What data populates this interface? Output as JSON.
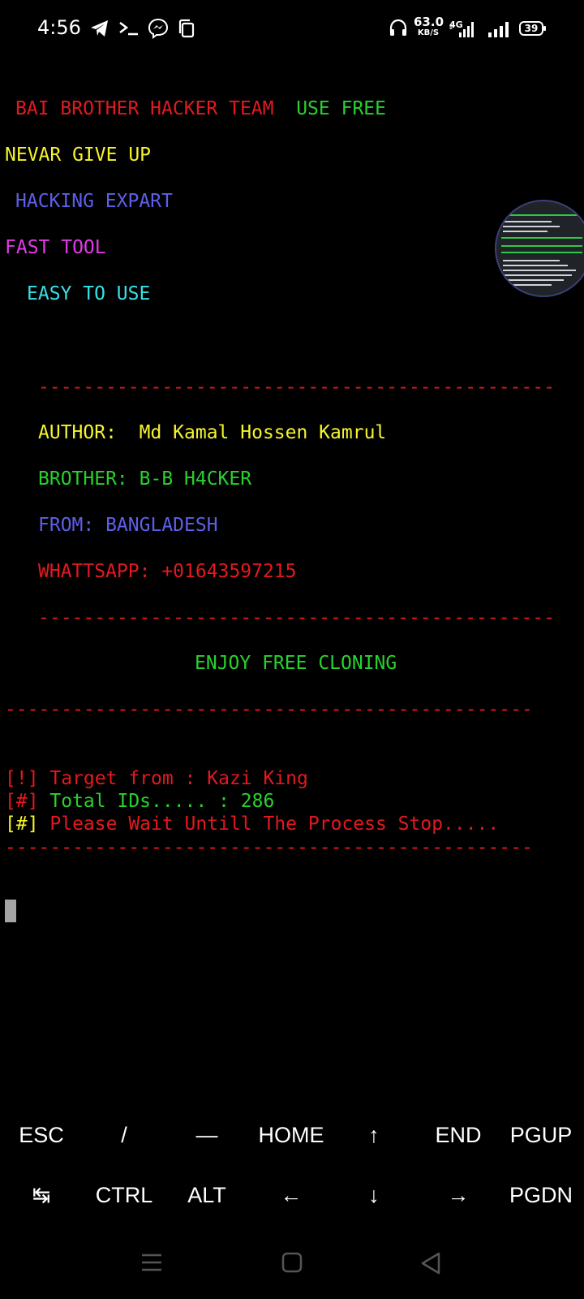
{
  "status_bar": {
    "time": "4:56",
    "net_speed_value": "63.0",
    "net_speed_unit": "KB/S",
    "network_type": "4G",
    "battery_level": "39",
    "icons": [
      "telegram-icon",
      "terminal-icon",
      "messenger-icon",
      "copy-icon",
      "headset-icon",
      "signal-4g-icon",
      "signal-icon",
      "battery-icon"
    ]
  },
  "banner": {
    "team": "BAI BROTHER HACKER TEAM",
    "use_free": "USE FREE",
    "never_give_up": "NEVAR GIVE UP",
    "hacking_expert": "HACKING EXPART",
    "fast_tool": "FAST TOOL",
    "easy_to_use": "EASY TO USE",
    "divider": "----------------------------------------------"
  },
  "info": {
    "author": "AUTHOR:  Md Kamal Hossen Kamrul",
    "brother": "BROTHER: B-B H4CKER",
    "from": "FROM: BANGLADESH",
    "whatsapp": "WHATTSAPP: +01643597215",
    "enjoy": "ENJOY FREE CLONING"
  },
  "output": {
    "target_prefix": "[!]",
    "target_text": " Target from : Kazi King",
    "total_prefix": "[#]",
    "total_text": " Total IDs..... : 286",
    "wait_prefix": "[#]",
    "wait_text": " Please Wait Untill The Process Stop.....",
    "divider_long": "-----------------------------------------------"
  },
  "extra_keys": {
    "row1": [
      "ESC",
      "/",
      "—",
      "HOME",
      "↑",
      "END",
      "PGUP"
    ],
    "row2": [
      "↹",
      "CTRL",
      "ALT",
      "←",
      "↓",
      "→",
      "PGDN"
    ]
  },
  "colors": {
    "red": "#e3191f",
    "green": "#28d22d",
    "yellow": "#f5f52c",
    "blue": "#5d5fe8",
    "magenta": "#e23ae7",
    "cyan": "#36e1e6",
    "background": "#000000"
  }
}
